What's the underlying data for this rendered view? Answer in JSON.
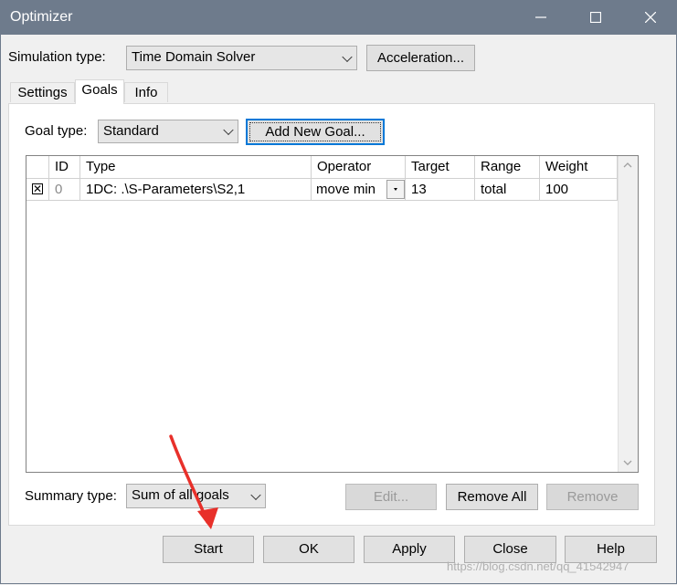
{
  "window": {
    "title": "Optimizer"
  },
  "simulation": {
    "label": "Simulation type:",
    "value": "Time Domain Solver",
    "acceleration_button": "Acceleration..."
  },
  "tabs": [
    {
      "label": "Settings"
    },
    {
      "label": "Goals"
    },
    {
      "label": "Info"
    }
  ],
  "goal_type": {
    "label": "Goal type:",
    "value": "Standard",
    "add_button": "Add New Goal..."
  },
  "table": {
    "columns": [
      "ID",
      "Type",
      "Operator",
      "Target",
      "Range",
      "Weight"
    ],
    "rows": [
      {
        "checked": "✕",
        "id": "0",
        "type": "1DC: .\\S-Parameters\\S2,1",
        "operator": "move min",
        "target": "13",
        "range": "total",
        "weight": "100"
      }
    ]
  },
  "summary": {
    "label": "Summary type:",
    "value": "Sum of all goals"
  },
  "goal_buttons": {
    "edit": "Edit...",
    "remove_all": "Remove All",
    "remove": "Remove"
  },
  "bottom_buttons": {
    "start": "Start",
    "ok": "OK",
    "apply": "Apply",
    "close": "Close",
    "help": "Help"
  },
  "watermark": "https://blog.csdn.net/qq_41542947",
  "colors": {
    "titlebar": "#6e7b8c",
    "focus": "#0078d7",
    "annotation_arrow": "#e8302a"
  }
}
